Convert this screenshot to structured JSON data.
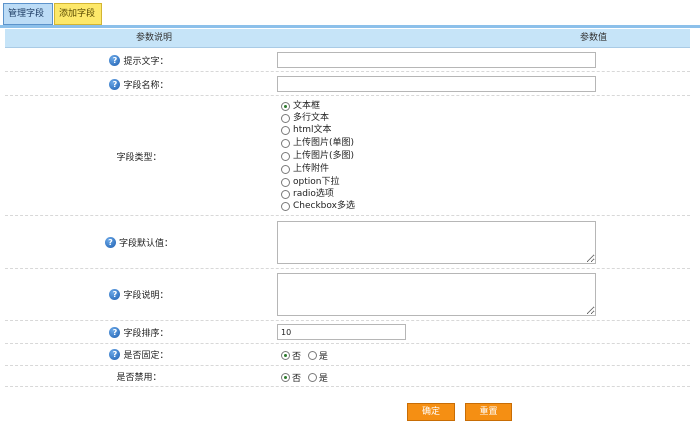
{
  "tabs": {
    "manage": "管理字段",
    "add": "添加字段"
  },
  "table_header": {
    "left": "参数说明",
    "right": "参数值"
  },
  "fields": {
    "hint_text": {
      "label": "提示文字：",
      "value": ""
    },
    "field_name": {
      "label": "字段名称：",
      "value": ""
    },
    "field_type": {
      "label": "字段类型：",
      "options": [
        {
          "label": "文本框",
          "checked": true
        },
        {
          "label": "多行文本",
          "checked": false
        },
        {
          "label": "html文本",
          "checked": false
        },
        {
          "label": "上传图片(单图)",
          "checked": false
        },
        {
          "label": "上传图片(多图)",
          "checked": false
        },
        {
          "label": "上传附件",
          "checked": false
        },
        {
          "label": "option下拉",
          "checked": false
        },
        {
          "label": "radio选项",
          "checked": false
        },
        {
          "label": "Checkbox多选",
          "checked": false
        }
      ]
    },
    "default_value": {
      "label": "字段默认值：",
      "value": ""
    },
    "description": {
      "label": "字段说明：",
      "value": ""
    },
    "sort_order": {
      "label": "字段排序：",
      "value": "10"
    },
    "is_fixed": {
      "label": "是否固定：",
      "options": [
        {
          "label": "否",
          "checked": true
        },
        {
          "label": "是",
          "checked": false
        }
      ]
    },
    "is_disabled": {
      "label": "是否禁用：",
      "options": [
        {
          "label": "否",
          "checked": true
        },
        {
          "label": "是",
          "checked": false
        }
      ]
    }
  },
  "buttons": {
    "confirm": "确定",
    "reset": "重置"
  },
  "help_icon_glyph": "?",
  "colors": {
    "header_bg": "#c6e4f8",
    "tab_active": "#bcdcf6",
    "tab_add": "#fde86a",
    "button": "#f58f13"
  }
}
